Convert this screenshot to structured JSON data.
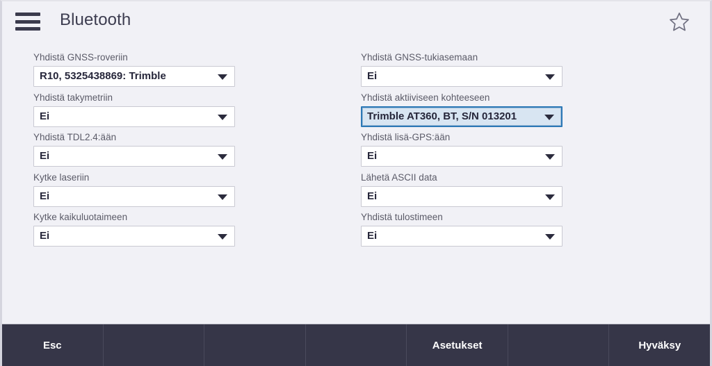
{
  "header": {
    "title": "Bluetooth",
    "menu_icon": "hamburger-menu-icon",
    "favorite_icon": "star-outline-icon"
  },
  "theme": {
    "background": "#f1f1f6",
    "accent": "#1b73ab",
    "bar_background": "#363648",
    "focus_border": "#2c78b6",
    "focus_fill": "#d8e5f2",
    "label_color": "#5b5b68",
    "value_color": "#26263a"
  },
  "form": {
    "left_column": [
      {
        "label": "Yhdistä GNSS-roveriin",
        "value": "R10, 5325438869: Trimble",
        "focused": false,
        "name": "connect-gnss-rover"
      },
      {
        "label": "Yhdistä takymetriin",
        "value": "Ei",
        "focused": false,
        "name": "connect-total-station"
      },
      {
        "label": "Yhdistä TDL2.4:ään",
        "value": "Ei",
        "focused": false,
        "name": "connect-tdl24"
      },
      {
        "label": "Kytke laseriin",
        "value": "Ei",
        "focused": false,
        "name": "connect-laser"
      },
      {
        "label": "Kytke kaikuluotaimeen",
        "value": "Ei",
        "focused": false,
        "name": "connect-echo-sounder"
      }
    ],
    "right_column": [
      {
        "label": "Yhdistä GNSS-tukiasemaan",
        "value": "Ei",
        "focused": false,
        "name": "connect-gnss-base"
      },
      {
        "label": "Yhdistä aktiiviseen kohteeseen",
        "value": "Trimble AT360, BT, S/N 013201",
        "focused": true,
        "name": "connect-active-target"
      },
      {
        "label": "Yhdistä lisä-GPS:ään",
        "value": "Ei",
        "focused": false,
        "name": "connect-aux-gps"
      },
      {
        "label": "Lähetä ASCII data",
        "value": "Ei",
        "focused": false,
        "name": "send-ascii-data"
      },
      {
        "label": "Yhdistä tulostimeen",
        "value": "Ei",
        "focused": false,
        "name": "connect-printer"
      }
    ],
    "caret_icon": "chevron-down-icon"
  },
  "bottom_bar": {
    "buttons": [
      {
        "label": "Esc",
        "name": "esc-button",
        "accent": false
      },
      {
        "label": "",
        "name": "softkey-2",
        "accent": false
      },
      {
        "label": "",
        "name": "softkey-3",
        "accent": false
      },
      {
        "label": "",
        "name": "softkey-4",
        "accent": false
      },
      {
        "label": "Asetukset",
        "name": "settings-button",
        "accent": false
      },
      {
        "label": "",
        "name": "softkey-6",
        "accent": false
      },
      {
        "label": "Hyväksy",
        "name": "accept-button",
        "accent": true
      }
    ]
  }
}
